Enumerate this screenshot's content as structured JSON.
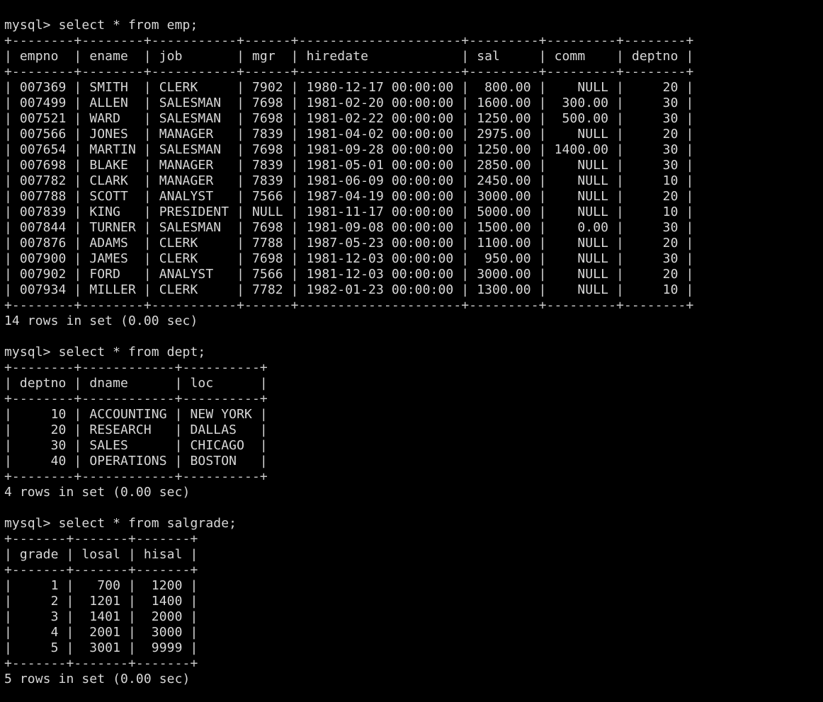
{
  "queries": [
    {
      "prompt": "mysql>",
      "command": "select * from emp;",
      "columns": [
        "empno",
        "ename",
        "job",
        "mgr",
        "hiredate",
        "sal",
        "comm",
        "deptno"
      ],
      "align": [
        "left",
        "left",
        "left",
        "left",
        "left",
        "right",
        "right",
        "right"
      ],
      "rows": [
        [
          "007369",
          "SMITH",
          "CLERK",
          "7902",
          "1980-12-17 00:00:00",
          "800.00",
          "NULL",
          "20"
        ],
        [
          "007499",
          "ALLEN",
          "SALESMAN",
          "7698",
          "1981-02-20 00:00:00",
          "1600.00",
          "300.00",
          "30"
        ],
        [
          "007521",
          "WARD",
          "SALESMAN",
          "7698",
          "1981-02-22 00:00:00",
          "1250.00",
          "500.00",
          "30"
        ],
        [
          "007566",
          "JONES",
          "MANAGER",
          "7839",
          "1981-04-02 00:00:00",
          "2975.00",
          "NULL",
          "20"
        ],
        [
          "007654",
          "MARTIN",
          "SALESMAN",
          "7698",
          "1981-09-28 00:00:00",
          "1250.00",
          "1400.00",
          "30"
        ],
        [
          "007698",
          "BLAKE",
          "MANAGER",
          "7839",
          "1981-05-01 00:00:00",
          "2850.00",
          "NULL",
          "30"
        ],
        [
          "007782",
          "CLARK",
          "MANAGER",
          "7839",
          "1981-06-09 00:00:00",
          "2450.00",
          "NULL",
          "10"
        ],
        [
          "007788",
          "SCOTT",
          "ANALYST",
          "7566",
          "1987-04-19 00:00:00",
          "3000.00",
          "NULL",
          "20"
        ],
        [
          "007839",
          "KING",
          "PRESIDENT",
          "NULL",
          "1981-11-17 00:00:00",
          "5000.00",
          "NULL",
          "10"
        ],
        [
          "007844",
          "TURNER",
          "SALESMAN",
          "7698",
          "1981-09-08 00:00:00",
          "1500.00",
          "0.00",
          "30"
        ],
        [
          "007876",
          "ADAMS",
          "CLERK",
          "7788",
          "1987-05-23 00:00:00",
          "1100.00",
          "NULL",
          "20"
        ],
        [
          "007900",
          "JAMES",
          "CLERK",
          "7698",
          "1981-12-03 00:00:00",
          "950.00",
          "NULL",
          "30"
        ],
        [
          "007902",
          "FORD",
          "ANALYST",
          "7566",
          "1981-12-03 00:00:00",
          "3000.00",
          "NULL",
          "20"
        ],
        [
          "007934",
          "MILLER",
          "CLERK",
          "7782",
          "1982-01-23 00:00:00",
          "1300.00",
          "NULL",
          "10"
        ]
      ],
      "result": "14 rows in set (0.00 sec)"
    },
    {
      "prompt": "mysql>",
      "command": "select * from dept;",
      "columns": [
        "deptno",
        "dname",
        "loc"
      ],
      "align": [
        "right",
        "left",
        "left"
      ],
      "rows": [
        [
          "10",
          "ACCOUNTING",
          "NEW YORK"
        ],
        [
          "20",
          "RESEARCH",
          "DALLAS"
        ],
        [
          "30",
          "SALES",
          "CHICAGO"
        ],
        [
          "40",
          "OPERATIONS",
          "BOSTON"
        ]
      ],
      "result": "4 rows in set (0.00 sec)"
    },
    {
      "prompt": "mysql>",
      "command": "select * from salgrade;",
      "columns": [
        "grade",
        "losal",
        "hisal"
      ],
      "align": [
        "right",
        "right",
        "right"
      ],
      "rows": [
        [
          "1",
          "700",
          "1200"
        ],
        [
          "2",
          "1201",
          "1400"
        ],
        [
          "3",
          "1401",
          "2000"
        ],
        [
          "4",
          "2001",
          "3000"
        ],
        [
          "5",
          "3001",
          "9999"
        ]
      ],
      "result": "5 rows in set (0.00 sec)"
    }
  ],
  "colors": {
    "background": "#000000",
    "text": "#d8d8d8"
  }
}
